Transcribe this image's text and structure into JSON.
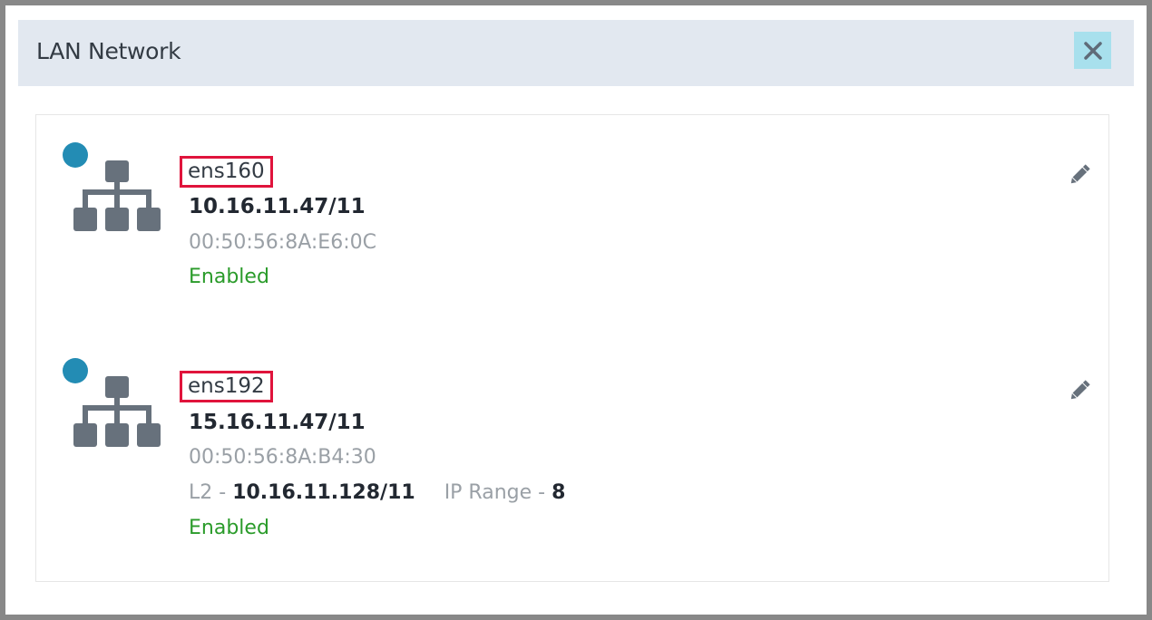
{
  "modal": {
    "title": "LAN Network",
    "close_label": "close"
  },
  "interfaces": [
    {
      "name": "ens160",
      "ip": "10.16.11.47/11",
      "mac": "00:50:56:8A:E6:0C",
      "status": "Enabled"
    },
    {
      "name": "ens192",
      "ip": "15.16.11.47/11",
      "mac": "00:50:56:8A:B4:30",
      "l2_label": "L2 - ",
      "l2_value": "10.16.11.128/11",
      "ip_range_label": "IP Range - ",
      "ip_range_value": "8",
      "status": "Enabled"
    }
  ],
  "colors": {
    "header_bg": "#e2e8f0",
    "close_bg": "#a8e0ed",
    "status_dot": "#238cb4",
    "enabled_text": "#2a9b2a",
    "highlight_border": "#e0143c",
    "icon_gray": "#67717c"
  },
  "icons": {
    "network": "sitemap-icon",
    "edit": "pencil-icon",
    "close": "close-icon"
  }
}
